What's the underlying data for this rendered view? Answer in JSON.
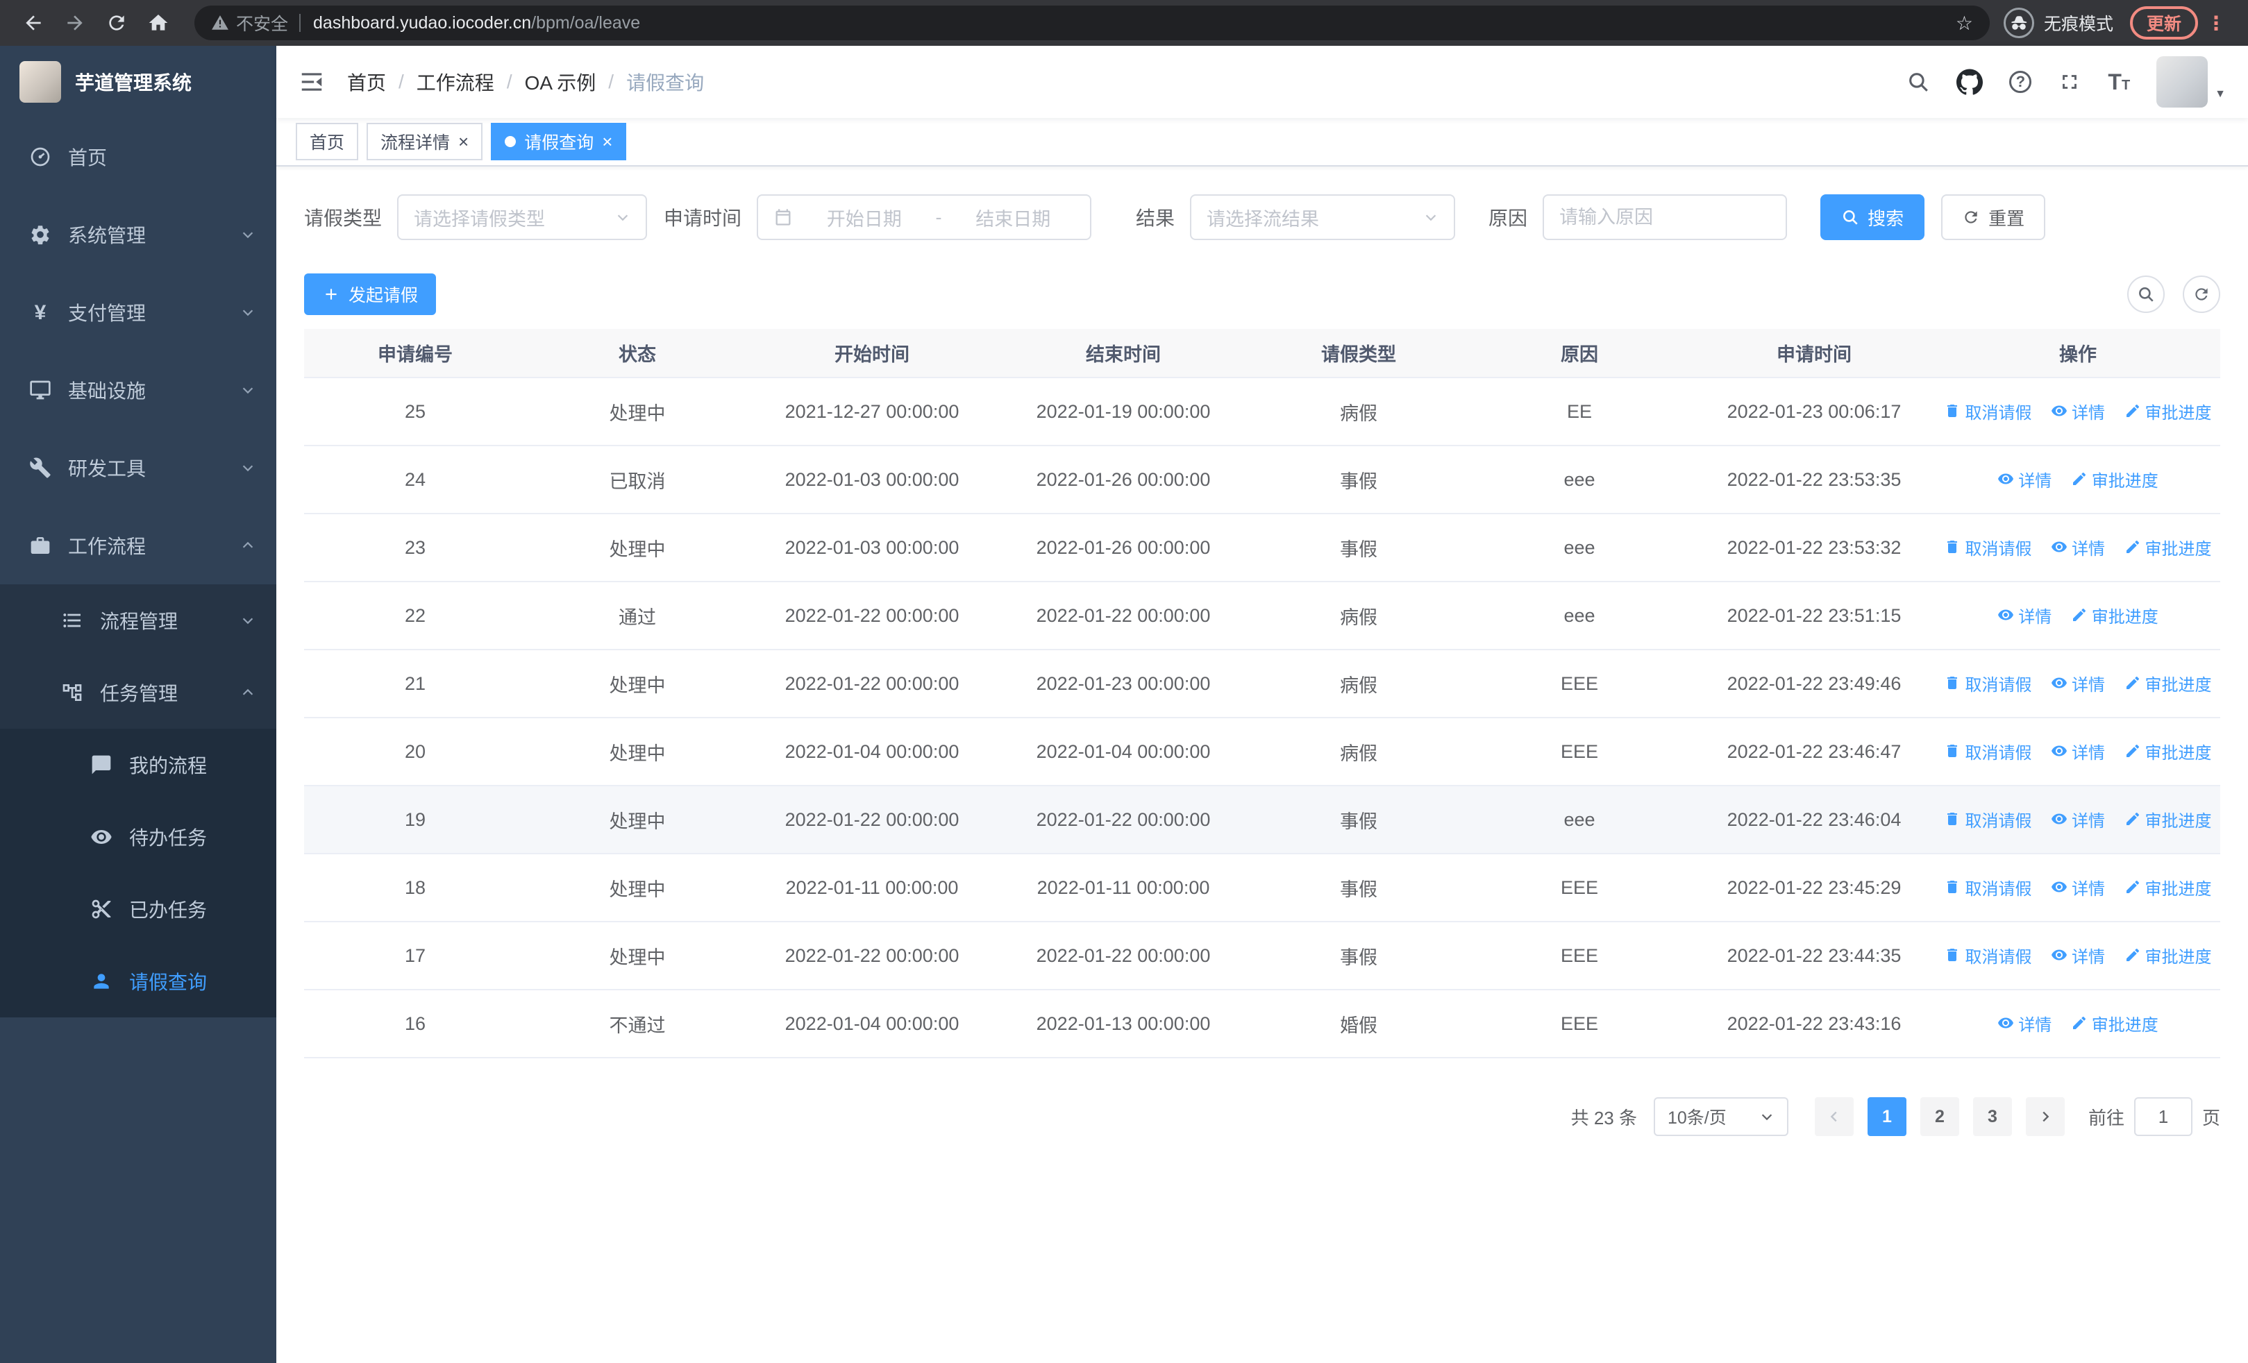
{
  "browser": {
    "security_label": "不安全",
    "url_host": "dashboard.yudao.iocoder.cn",
    "url_path": "/bpm/oa/leave",
    "incognito_label": "无痕模式",
    "update_label": "更新"
  },
  "icons": {
    "yen": "¥",
    "help": "?",
    "kebab": "⋮",
    "star": "☆",
    "font_size": "T",
    "close": "×",
    "caret": "▼"
  },
  "sidebar": {
    "app_title": "芋道管理系统",
    "items": [
      {
        "label": "首页"
      },
      {
        "label": "系统管理"
      },
      {
        "label": "支付管理"
      },
      {
        "label": "基础设施"
      },
      {
        "label": "研发工具"
      },
      {
        "label": "工作流程"
      }
    ],
    "workflow_children": [
      {
        "label": "流程管理"
      },
      {
        "label": "任务管理"
      }
    ],
    "task_children": [
      {
        "label": "我的流程"
      },
      {
        "label": "待办任务"
      },
      {
        "label": "已办任务"
      },
      {
        "label": "请假查询"
      }
    ]
  },
  "header": {
    "breadcrumb": [
      "首页",
      "工作流程",
      "OA 示例",
      "请假查询"
    ]
  },
  "tabs": [
    {
      "label": "首页"
    },
    {
      "label": "流程详情"
    },
    {
      "label": "请假查询"
    }
  ],
  "filters": {
    "leave_type_label": "请假类型",
    "leave_type_placeholder": "请选择请假类型",
    "apply_time_label": "申请时间",
    "date_start_placeholder": "开始日期",
    "date_separator": "-",
    "date_end_placeholder": "结束日期",
    "result_label": "结果",
    "result_placeholder": "请选择流结果",
    "reason_label": "原因",
    "reason_placeholder": "请输入原因",
    "search_button": "搜索",
    "reset_button": "重置"
  },
  "toolbar": {
    "create_button": "发起请假"
  },
  "table": {
    "columns": [
      "申请编号",
      "状态",
      "开始时间",
      "结束时间",
      "请假类型",
      "原因",
      "申请时间",
      "操作"
    ],
    "actions": {
      "cancel": "取消请假",
      "detail": "详情",
      "progress": "审批进度"
    },
    "rows": [
      {
        "id": "25",
        "status": "处理中",
        "start": "2021-12-27 00:00:00",
        "end": "2022-01-19 00:00:00",
        "type": "病假",
        "reason": "EE",
        "applied": "2022-01-23 00:06:17",
        "cancelable": true,
        "hover": false
      },
      {
        "id": "24",
        "status": "已取消",
        "start": "2022-01-03 00:00:00",
        "end": "2022-01-26 00:00:00",
        "type": "事假",
        "reason": "eee",
        "applied": "2022-01-22 23:53:35",
        "cancelable": false,
        "hover": false
      },
      {
        "id": "23",
        "status": "处理中",
        "start": "2022-01-03 00:00:00",
        "end": "2022-01-26 00:00:00",
        "type": "事假",
        "reason": "eee",
        "applied": "2022-01-22 23:53:32",
        "cancelable": true,
        "hover": false
      },
      {
        "id": "22",
        "status": "通过",
        "start": "2022-01-22 00:00:00",
        "end": "2022-01-22 00:00:00",
        "type": "病假",
        "reason": "eee",
        "applied": "2022-01-22 23:51:15",
        "cancelable": false,
        "hover": false
      },
      {
        "id": "21",
        "status": "处理中",
        "start": "2022-01-22 00:00:00",
        "end": "2022-01-23 00:00:00",
        "type": "病假",
        "reason": "EEE",
        "applied": "2022-01-22 23:49:46",
        "cancelable": true,
        "hover": false
      },
      {
        "id": "20",
        "status": "处理中",
        "start": "2022-01-04 00:00:00",
        "end": "2022-01-04 00:00:00",
        "type": "病假",
        "reason": "EEE",
        "applied": "2022-01-22 23:46:47",
        "cancelable": true,
        "hover": false
      },
      {
        "id": "19",
        "status": "处理中",
        "start": "2022-01-22 00:00:00",
        "end": "2022-01-22 00:00:00",
        "type": "事假",
        "reason": "eee",
        "applied": "2022-01-22 23:46:04",
        "cancelable": true,
        "hover": true
      },
      {
        "id": "18",
        "status": "处理中",
        "start": "2022-01-11 00:00:00",
        "end": "2022-01-11 00:00:00",
        "type": "事假",
        "reason": "EEE",
        "applied": "2022-01-22 23:45:29",
        "cancelable": true,
        "hover": false
      },
      {
        "id": "17",
        "status": "处理中",
        "start": "2022-01-22 00:00:00",
        "end": "2022-01-22 00:00:00",
        "type": "事假",
        "reason": "EEE",
        "applied": "2022-01-22 23:44:35",
        "cancelable": true,
        "hover": false
      },
      {
        "id": "16",
        "status": "不通过",
        "start": "2022-01-04 00:00:00",
        "end": "2022-01-13 00:00:00",
        "type": "婚假",
        "reason": "EEE",
        "applied": "2022-01-22 23:43:16",
        "cancelable": false,
        "hover": false
      }
    ]
  },
  "pagination": {
    "total_text": "共 23 条",
    "page_size": "10条/页",
    "pages": [
      "1",
      "2",
      "3"
    ],
    "goto_label": "前往",
    "goto_value": "1",
    "goto_suffix": "页"
  },
  "colors": {
    "primary": "#409eff",
    "sidebar_bg": "#304156",
    "submenu_bg": "#1f2d3d"
  }
}
